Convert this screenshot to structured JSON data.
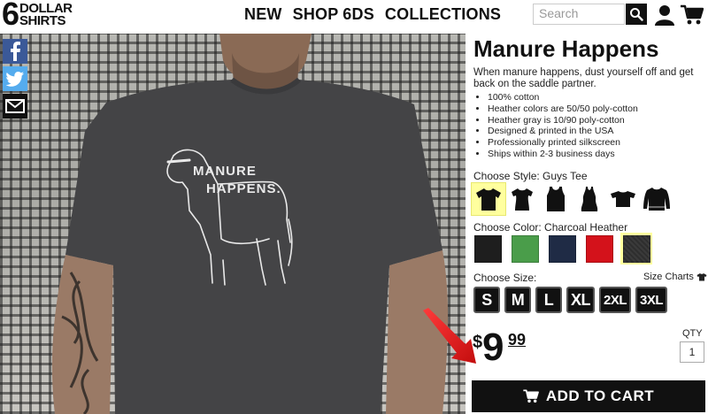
{
  "header": {
    "logo": {
      "mark": "6",
      "line1": "DOLLAR",
      "line2": "SHIRTS"
    },
    "nav": [
      "NEW",
      "SHOP 6DS",
      "COLLECTIONS"
    ],
    "search": {
      "placeholder": "Search",
      "icon": "search-icon"
    },
    "account_icon": "user-icon",
    "cart_icon": "cart-icon"
  },
  "share": [
    "facebook-icon",
    "twitter-icon",
    "email-icon"
  ],
  "product": {
    "title": "Manure Happens",
    "description": "When manure happens, dust yourself off and get back on the saddle partner.",
    "features": [
      "100% cotton",
      "Heather colors are 50/50 poly-cotton",
      "Heather gray is 10/90 poly-cotton",
      "Designed & printed in the USA",
      "Professionally printed silkscreen",
      "Ships within 2-3 business days"
    ],
    "shirt_print": {
      "line1": "MANURE",
      "line2": "HAPPENS."
    },
    "style": {
      "label": "Choose Style: Guys Tee",
      "options": [
        "guys-tee",
        "ladies-tee",
        "tank-top",
        "racerback-tank",
        "crop-tee",
        "sweatshirt"
      ],
      "selected": 0
    },
    "color": {
      "label": "Choose Color: Charcoal Heather",
      "swatches": [
        {
          "name": "black",
          "hex": "#1e1e1e"
        },
        {
          "name": "green",
          "hex": "#4a9d4a"
        },
        {
          "name": "navy",
          "hex": "#1f2b45"
        },
        {
          "name": "red",
          "hex": "#d4121b"
        },
        {
          "name": "charcoal-heather",
          "hex": "#2e2e2e"
        }
      ],
      "selected": 4
    },
    "size": {
      "label": "Choose Size:",
      "chart_link": "Size Charts",
      "options": [
        "S",
        "M",
        "L",
        "XL",
        "2XL",
        "3XL"
      ]
    },
    "price": {
      "currency": "$",
      "whole": "9",
      "cents": "99"
    },
    "qty": {
      "label": "QTY",
      "value": "1"
    },
    "add_to_cart": "ADD TO CART"
  },
  "colors": {
    "accent_highlight": "#ffff9e",
    "button": "#111111",
    "annotation_arrow": "#e41a1a"
  }
}
